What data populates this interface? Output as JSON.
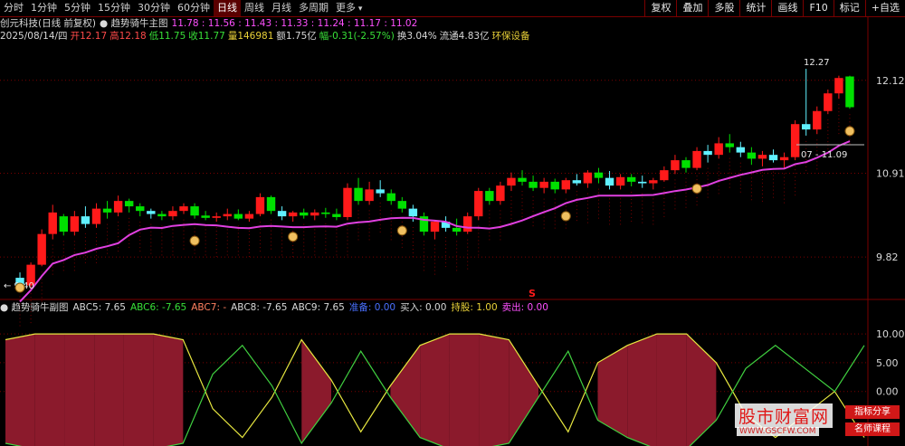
{
  "tabs": [
    "分时",
    "1分钟",
    "5分钟",
    "15分钟",
    "30分钟",
    "60分钟",
    "日线",
    "周线",
    "月线",
    "多周期",
    "更多"
  ],
  "active_tab": "日线",
  "toolbar": [
    "复权",
    "叠加",
    "多股",
    "统计",
    "画线",
    "F10",
    "标记",
    "+自选"
  ],
  "stock": {
    "name": "创元科技(日线 前复权)",
    "indicator": "趋势骑牛主图",
    "ma_values": [
      "11.78",
      "11.56",
      "11.43",
      "11.33",
      "11.24",
      "11.17",
      "11.02"
    ]
  },
  "quote": {
    "date": "2025/08/14/四",
    "open_label": "开",
    "open": "12.17",
    "high_label": "高",
    "high": "12.18",
    "low_label": "低",
    "low": "11.75",
    "close_label": "收",
    "close": "11.77",
    "vol_label": "量",
    "vol": "146981",
    "amount_label": "额",
    "amount": "1.75亿",
    "chg_label": "幅",
    "chg": "-0.31(-2.57%)",
    "turnover_label": "换",
    "turnover": "3.04%",
    "float_label": "流通",
    "float": "4.83亿",
    "sector": "环保设备"
  },
  "sub": {
    "title": "趋势骑牛副图",
    "abc5": "ABC5: 7.65",
    "abc6": "ABC6: -7.65",
    "abc7": "ABC7: -",
    "abc8": "ABC8: -7.65",
    "abc9": "ABC9: 7.65",
    "zhunbei": "准备: 0.00",
    "buy": "买入: 0.00",
    "hold": "持股: 1.00",
    "sell": "卖出: 0.00"
  },
  "annotations": {
    "high_mark": "12.27",
    "low_mark": "9.40",
    "ma_mark": "07 - 11.09",
    "s_mark": "S"
  },
  "watermark": {
    "big": "股市财富网",
    "url": "WWW.GSCFW.COM",
    "b1": "指标分享",
    "b2": "名师课程"
  },
  "colors": {
    "up": "#ff1a1a",
    "down": "#00e000",
    "cyan": "#60f0ff",
    "ma": "#e040e0",
    "area": "#8b1a2c",
    "yellow": "#e8e840",
    "green_line": "#40d040"
  },
  "chart_data": [
    {
      "type": "candlestick",
      "y_axis_ticks": [
        12.12,
        10.91,
        9.82
      ],
      "ylim": [
        9.28,
        12.6
      ],
      "candles": [
        [
          9.55,
          9.62,
          9.38,
          9.42
        ],
        [
          9.45,
          9.75,
          9.42,
          9.72
        ],
        [
          9.72,
          10.18,
          9.7,
          10.12
        ],
        [
          10.12,
          10.5,
          10.05,
          10.4
        ],
        [
          10.35,
          10.38,
          10.1,
          10.15
        ],
        [
          10.15,
          10.42,
          10.1,
          10.35
        ],
        [
          10.35,
          10.48,
          10.2,
          10.25
        ],
        [
          10.25,
          10.52,
          10.2,
          10.45
        ],
        [
          10.45,
          10.55,
          10.32,
          10.4
        ],
        [
          10.4,
          10.62,
          10.35,
          10.55
        ],
        [
          10.55,
          10.58,
          10.4,
          10.48
        ],
        [
          10.48,
          10.52,
          10.35,
          10.42
        ],
        [
          10.42,
          10.45,
          10.32,
          10.38
        ],
        [
          10.38,
          10.42,
          10.3,
          10.35
        ],
        [
          10.35,
          10.48,
          10.3,
          10.42
        ],
        [
          10.42,
          10.52,
          10.38,
          10.48
        ],
        [
          10.48,
          10.52,
          10.32,
          10.36
        ],
        [
          10.36,
          10.42,
          10.3,
          10.33
        ],
        [
          10.33,
          10.4,
          10.28,
          10.35
        ],
        [
          10.35,
          10.45,
          10.3,
          10.38
        ],
        [
          10.38,
          10.44,
          10.3,
          10.32
        ],
        [
          10.32,
          10.42,
          10.28,
          10.38
        ],
        [
          10.38,
          10.65,
          10.35,
          10.6
        ],
        [
          10.6,
          10.62,
          10.38,
          10.42
        ],
        [
          10.42,
          10.48,
          10.3,
          10.35
        ],
        [
          10.35,
          10.42,
          10.28,
          10.4
        ],
        [
          10.4,
          10.45,
          10.32,
          10.36
        ],
        [
          10.36,
          10.44,
          10.3,
          10.4
        ],
        [
          10.4,
          10.46,
          10.33,
          10.38
        ],
        [
          10.38,
          10.45,
          10.3,
          10.34
        ],
        [
          10.34,
          10.78,
          10.3,
          10.72
        ],
        [
          10.72,
          10.85,
          10.5,
          10.55
        ],
        [
          10.55,
          10.8,
          10.5,
          10.7
        ],
        [
          10.7,
          10.82,
          10.6,
          10.65
        ],
        [
          10.65,
          10.7,
          10.5,
          10.55
        ],
        [
          10.55,
          10.6,
          10.4,
          10.45
        ],
        [
          10.45,
          10.5,
          10.28,
          10.35
        ],
        [
          10.35,
          10.4,
          10.1,
          10.15
        ],
        [
          10.15,
          10.3,
          10.05,
          10.28
        ],
        [
          10.28,
          10.35,
          10.15,
          10.2
        ],
        [
          10.2,
          10.32,
          10.1,
          10.15
        ],
        [
          10.15,
          10.4,
          10.12,
          10.35
        ],
        [
          10.35,
          10.72,
          10.3,
          10.68
        ],
        [
          10.68,
          10.72,
          10.5,
          10.55
        ],
        [
          10.55,
          10.8,
          10.5,
          10.75
        ],
        [
          10.75,
          10.92,
          10.68,
          10.85
        ],
        [
          10.85,
          10.95,
          10.75,
          10.8
        ],
        [
          10.8,
          10.88,
          10.68,
          10.72
        ],
        [
          10.72,
          10.85,
          10.65,
          10.8
        ],
        [
          10.8,
          10.84,
          10.65,
          10.7
        ],
        [
          10.7,
          10.85,
          10.65,
          10.82
        ],
        [
          10.82,
          10.9,
          10.75,
          10.78
        ],
        [
          10.78,
          10.95,
          10.72,
          10.92
        ],
        [
          10.92,
          10.98,
          10.78,
          10.85
        ],
        [
          10.85,
          10.94,
          10.7,
          10.75
        ],
        [
          10.75,
          10.9,
          10.7,
          10.86
        ],
        [
          10.86,
          10.9,
          10.74,
          10.8
        ],
        [
          10.8,
          10.88,
          10.72,
          10.78
        ],
        [
          10.78,
          10.85,
          10.7,
          10.82
        ],
        [
          10.82,
          11.0,
          10.8,
          10.95
        ],
        [
          10.95,
          11.15,
          10.9,
          11.08
        ],
        [
          11.08,
          11.12,
          10.92,
          10.98
        ],
        [
          10.98,
          11.25,
          10.95,
          11.2
        ],
        [
          11.2,
          11.28,
          11.05,
          11.15
        ],
        [
          11.15,
          11.38,
          11.1,
          11.3
        ],
        [
          11.3,
          11.42,
          11.18,
          11.25
        ],
        [
          11.25,
          11.32,
          11.12,
          11.18
        ],
        [
          11.18,
          11.25,
          11.02,
          11.1
        ],
        [
          11.1,
          11.2,
          11.0,
          11.15
        ],
        [
          11.15,
          11.22,
          11.05,
          11.08
        ],
        [
          11.08,
          11.18,
          10.98,
          11.12
        ],
        [
          11.12,
          11.6,
          11.08,
          11.55
        ],
        [
          11.55,
          12.27,
          11.4,
          11.48
        ],
        [
          11.48,
          11.78,
          11.42,
          11.72
        ],
        [
          11.72,
          12.0,
          11.68,
          11.95
        ],
        [
          11.95,
          12.18,
          11.88,
          12.15
        ],
        [
          12.17,
          12.18,
          11.75,
          11.77
        ]
      ]
    },
    {
      "type": "oscillator",
      "y_axis_ticks": [
        10.0,
        5.0,
        0.0
      ],
      "ylim": [
        -9,
        13
      ],
      "abc5": [
        9,
        10,
        10,
        10,
        10,
        10,
        9,
        -3,
        -8,
        -1,
        9,
        2,
        -7,
        1,
        8,
        10,
        10,
        9,
        1,
        -7,
        5,
        8,
        10,
        10,
        5,
        -4,
        -8,
        -4,
        0,
        -8
      ],
      "abc6": [
        -9,
        -10,
        -10,
        -10,
        -10,
        -10,
        -9,
        3,
        8,
        1,
        -9,
        -2,
        7,
        -1,
        -8,
        -10,
        -10,
        -9,
        -1,
        7,
        -5,
        -8,
        -10,
        -10,
        -5,
        4,
        8,
        4,
        0,
        8
      ]
    }
  ]
}
